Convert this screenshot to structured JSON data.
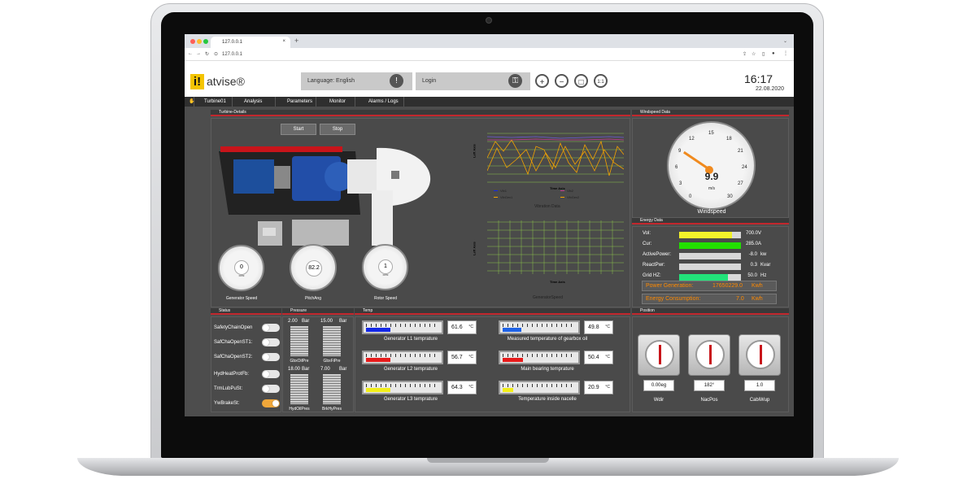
{
  "browser": {
    "tab_title": "127.0.0.1",
    "url": "127.0.0.1"
  },
  "header": {
    "logo_mark": "i!",
    "logo_text": "atvise®",
    "language": "Language: English",
    "login": "Login",
    "time": "16:17",
    "date": "22.08.2020"
  },
  "menu": [
    {
      "label": "Turbine01"
    },
    {
      "label": "Analysis"
    },
    {
      "label": "Parameters"
    },
    {
      "label": "Monitor"
    },
    {
      "label": "Alarms / Logs"
    }
  ],
  "panels": {
    "turbine": "Turbine-Details",
    "windspeed": "Windspeed Data",
    "energy": "Energy Data",
    "status": "Status",
    "pressure": "Pressure",
    "temp": "Temp",
    "position": "Position"
  },
  "turbine": {
    "start": "Start",
    "stop": "Stop",
    "gauges": [
      {
        "label": "Generator Speed",
        "value": "0",
        "unit": "RPM"
      },
      {
        "label": "PitchAng",
        "value": "82.2",
        "unit": ""
      },
      {
        "label": "Rotor Speed",
        "value": "1",
        "unit": "RPM"
      }
    ]
  },
  "vibration_chart": {
    "title": "Vibration Data",
    "y_label": "Left Axis",
    "x_label": "Time Axis",
    "legend": [
      "Vib1",
      "Vib2",
      "VibGex1",
      "VibGex2"
    ]
  },
  "generator_chart": {
    "title": "GeneratorSpeed",
    "y_label": "Left Axis",
    "x_label": "Time Axis"
  },
  "windspeed": {
    "value": "9.9",
    "unit": "m/s",
    "label": "Windspeed",
    "ticks": [
      "0",
      "3",
      "6",
      "9",
      "12",
      "15",
      "18",
      "21",
      "24",
      "27",
      "30"
    ]
  },
  "energy": {
    "rows": [
      {
        "label": "Vol:",
        "value": "700.0V",
        "unit": "",
        "fill": 0.86,
        "color": "#f3f32a"
      },
      {
        "label": "Cur:",
        "value": "285.0A",
        "unit": "",
        "fill": 1.0,
        "color": "#22e000"
      },
      {
        "label": "ActivePower:",
        "value": "-8.0",
        "unit": "kw",
        "fill": 0,
        "color": "#d8d8d8"
      },
      {
        "label": "ReactPwr:",
        "value": "0.3",
        "unit": "Kvar",
        "fill": 0,
        "color": "#d8d8d8"
      },
      {
        "label": "Grid HZ:",
        "value": "50.0",
        "unit": "Hz",
        "fill": 0.79,
        "color": "#22e37a"
      }
    ],
    "generation": {
      "label": "Power Generation:",
      "value": "17650229.0",
      "unit": "Kwh"
    },
    "consumption": {
      "label": "Energy Consumption:",
      "value": "7.0",
      "unit": "Kwh"
    }
  },
  "status": [
    {
      "label": "SafetyChainOpen",
      "on": false
    },
    {
      "label": "SafChaOpenST1:",
      "on": false
    },
    {
      "label": "SafChaOpenST2:",
      "on": false
    },
    {
      "label": "HydHeatProtFb:",
      "on": false
    },
    {
      "label": "TrmLubPuSt:",
      "on": false
    },
    {
      "label": "YwBrakeSt:",
      "on": true
    }
  ],
  "pressure": [
    {
      "label": "GbxOilPre",
      "value": "2.00",
      "unit": "Bar"
    },
    {
      "label": "GbxFiPre",
      "value": "15.00",
      "unit": "Bar"
    },
    {
      "label": "HydOilPres",
      "value": "18.00",
      "unit": "Bar"
    },
    {
      "label": "BrkHyPres",
      "value": "7.00",
      "unit": "Bar"
    }
  ],
  "temps": [
    {
      "label": "Generator L1 temprature",
      "value": "61.6",
      "unit": "°C",
      "fill": 0.33,
      "color": "#1428e6"
    },
    {
      "label": "Generator L2 temprature",
      "value": "56.7",
      "unit": "°C",
      "fill": 0.33,
      "color": "#e61b1b"
    },
    {
      "label": "Generator L3 temprature",
      "value": "64.3",
      "unit": "°C",
      "fill": 0.33,
      "color": "#f2ee18"
    },
    {
      "label": "Measured temperature of gearbox oil",
      "value": "49.8",
      "unit": "°C",
      "fill": 0.26,
      "color": "#1f63e6"
    },
    {
      "label": "Main bearing temprature",
      "value": "50.4",
      "unit": "°C",
      "fill": 0.28,
      "color": "#e61b1b"
    },
    {
      "label": "Temperature inside nacelle",
      "value": "20.9",
      "unit": "°C",
      "fill": 0.14,
      "color": "#f2ee18"
    }
  ],
  "position": [
    {
      "label": "Wdir",
      "value": "0.00eg"
    },
    {
      "label": "NacPos",
      "value": "182°"
    },
    {
      "label": "CabiWup",
      "value": "1.0"
    }
  ]
}
